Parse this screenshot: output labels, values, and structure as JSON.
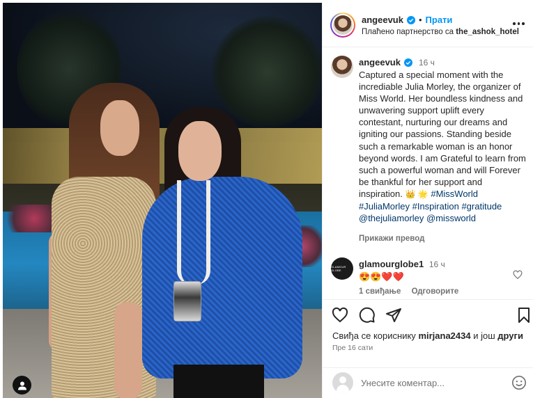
{
  "header": {
    "username": "angeevuk",
    "separator": "•",
    "follow_label": "Прати",
    "partner_prefix": "Плаћено партнерство са",
    "partner_name": "the_ashok_hotel"
  },
  "caption": {
    "username": "angeevuk",
    "time": "16 ч",
    "text": "Captured a special moment with the incrediable Julia Morley, the organizer of Miss World. Her boundless kindness and unwavering support uplift every contestant, nurturing our dreams and igniting our passions. Standing beside such a remarkable woman is an honor beyond words. I am Grateful to learn from such a powerful woman and will Forever be thankful for her support and inspiration.",
    "emojis": "👑 🌟",
    "hashtags": [
      "#MissWorld",
      "#JuliaMorley",
      "#Inspiration",
      "#gratitude",
      "@thejuliamorley",
      "@missworld"
    ],
    "translate_label": "Прикажи превод"
  },
  "comment": {
    "username": "glamourglobe1",
    "time": "16 ч",
    "avatar_text": "GLAMOUR GLOBE",
    "text": "😍😍❤️❤️",
    "likes_label": "1 свиђање",
    "reply_label": "Одговорите"
  },
  "actions": {
    "likes_prefix": "Свиђа се кориснику",
    "liked_by": "mirjana2434",
    "likes_middle": "и још",
    "likes_suffix": "други",
    "ago": "Пре 16 сати"
  },
  "add_comment": {
    "placeholder": "Унесите коментар..."
  },
  "colors": {
    "link": "#00376b",
    "follow": "#0095f6",
    "muted": "#737373"
  }
}
